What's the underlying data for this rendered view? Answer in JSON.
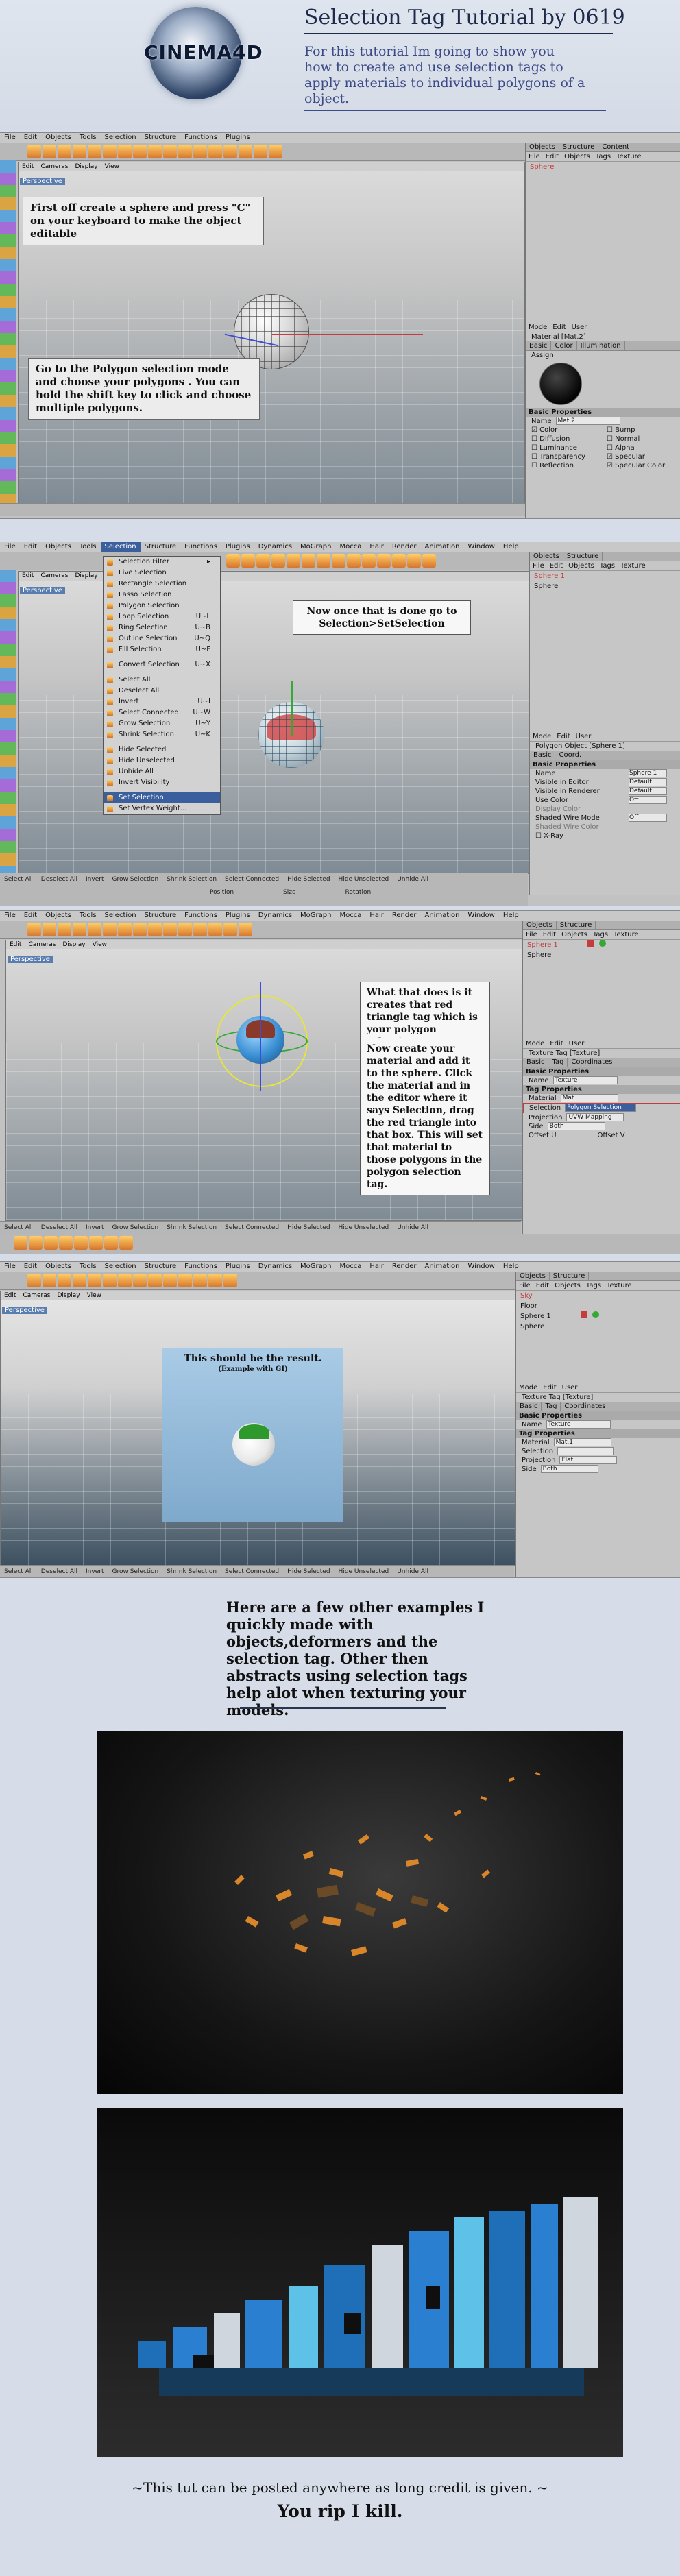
{
  "header": {
    "logo_text": "CINEMA4D",
    "title": "Selection Tag Tutorial by 0619",
    "intro": "For this tutorial Im going to show you how to create and use selection tags to apply materials to individual polygons of a object."
  },
  "app": {
    "menu": [
      "File",
      "Edit",
      "Objects",
      "Tools",
      "Selection",
      "Structure",
      "Functions",
      "Plugins",
      "Dynamics",
      "MoGraph",
      "Mocca",
      "Hair",
      "Render",
      "Animation",
      "Window",
      "Help"
    ],
    "viewport_menu": [
      "Edit",
      "Cameras",
      "Display",
      "View"
    ],
    "viewport_label": "Perspective",
    "panel_tabs": [
      "Objects",
      "Structure",
      "Content"
    ],
    "panel_menu": [
      "File",
      "Edit",
      "Objects",
      "Tags",
      "Texture"
    ],
    "attr_menu": [
      "Mode",
      "Edit",
      "User"
    ],
    "bottom_items": [
      "Select All",
      "Deselect All",
      "Invert",
      "Grow Selection",
      "Shrink Selection",
      "Select Connected",
      "Hide Selected",
      "Hide Unselected",
      "Unhide All"
    ]
  },
  "steps": [
    {
      "callouts": [
        "First off create a sphere and press \"C\" on your keyboard to make the object editable",
        "Go to the Polygon selection mode and choose your polygons . You can hold the shift key to click and choose multiple polygons."
      ],
      "objects": [
        "Sphere"
      ],
      "attr_title": "Material [Mat.2]",
      "attr_tabs": [
        "Basic",
        "Color",
        "Illumination"
      ],
      "section": "Basic Properties",
      "name_label": "Name",
      "name_value": "Mat.2",
      "checks_left": [
        "Color",
        "Diffusion",
        "Luminance",
        "Transparency",
        "Reflection"
      ],
      "checks_right": [
        "Bump",
        "Normal",
        "Alpha",
        "Specular",
        "Specular Color"
      ],
      "assign_label": "Assign"
    },
    {
      "callout": "Now once that is done go to Selection>SetSelection",
      "objects": [
        "Sphere 1",
        "Sphere"
      ],
      "dropdown": [
        {
          "label": "Selection Filter",
          "sc": ""
        },
        {
          "label": "Live Selection",
          "sc": ""
        },
        {
          "label": "Rectangle Selection",
          "sc": ""
        },
        {
          "label": "Lasso Selection",
          "sc": ""
        },
        {
          "label": "Polygon Selection",
          "sc": ""
        },
        {
          "label": "Loop Selection",
          "sc": "U~L"
        },
        {
          "label": "Ring Selection",
          "sc": "U~B"
        },
        {
          "label": "Outline Selection",
          "sc": "U~Q"
        },
        {
          "label": "Fill Selection",
          "sc": "U~F"
        },
        {
          "label": "Convert Selection",
          "sc": "U~X"
        },
        {
          "label": "Select All",
          "sc": ""
        },
        {
          "label": "Deselect All",
          "sc": ""
        },
        {
          "label": "Invert",
          "sc": "U~I"
        },
        {
          "label": "Select Connected",
          "sc": "U~W"
        },
        {
          "label": "Grow Selection",
          "sc": "U~Y"
        },
        {
          "label": "Shrink Selection",
          "sc": "U~K"
        },
        {
          "label": "Hide Selected",
          "sc": ""
        },
        {
          "label": "Hide Unselected",
          "sc": ""
        },
        {
          "label": "Unhide All",
          "sc": ""
        },
        {
          "label": "Invert Visibility",
          "sc": ""
        },
        {
          "label": "Set Selection",
          "sc": ""
        },
        {
          "label": "Set Vertex Weight...",
          "sc": ""
        }
      ],
      "attr_title": "Polygon Object [Sphere 1]",
      "attr_tabs": [
        "Basic",
        "Coord."
      ],
      "section": "Basic Properties",
      "props": [
        {
          "label": "Name",
          "value": "Sphere 1"
        },
        {
          "label": "Visible in Editor",
          "value": "Default"
        },
        {
          "label": "Visible in Renderer",
          "value": "Default"
        },
        {
          "label": "Use Color",
          "value": "Off"
        },
        {
          "label": "Display Color",
          "value": ""
        },
        {
          "label": "Shaded Wire Mode",
          "value": "Off"
        },
        {
          "label": "Shaded Wire Color",
          "value": ""
        }
      ],
      "xray_label": "X-Ray",
      "status_items": [
        "Position",
        "Size",
        "Rotation"
      ]
    },
    {
      "callouts": [
        "What that does is it creates that red triangle tag which is your polygon selection",
        "Now create your material and add it to the sphere. Click the material and in the editor where it says Selection, drag the red triangle into that box. This will set that material to those polygons in the polygon selection tag."
      ],
      "objects": [
        "Sphere 1",
        "Sphere"
      ],
      "attr_title": "Texture Tag [Texture]",
      "attr_tabs": [
        "Basic",
        "Tag",
        "Coordinates"
      ],
      "section": "Basic Properties",
      "name_label": "Name",
      "name_value": "Texture",
      "tag_section": "Tag Properties",
      "props": [
        {
          "label": "Material",
          "value": "Mat"
        },
        {
          "label": "Selection",
          "value": "Polygon Selection"
        },
        {
          "label": "Projection",
          "value": "UVW Mapping"
        },
        {
          "label": "Side",
          "value": "Both"
        }
      ],
      "offset_labels": [
        "Offset U",
        "Offset V"
      ]
    },
    {
      "callout_title": "This should be the result.",
      "callout_sub": "(Example with GI)",
      "objects": [
        "Sky",
        "Floor",
        "Sphere 1",
        "Sphere"
      ],
      "attr_title": "Texture Tag [Texture]",
      "attr_tabs": [
        "Basic",
        "Tag",
        "Coordinates"
      ],
      "section": "Basic Properties",
      "name_label": "Name",
      "name_value": "Texture",
      "tag_section": "Tag Properties",
      "props": [
        {
          "label": "Material",
          "value": "Mat.1"
        },
        {
          "label": "Selection",
          "value": ""
        },
        {
          "label": "Projection",
          "value": "Flat"
        },
        {
          "label": "Side",
          "value": "Both"
        }
      ]
    }
  ],
  "examples": {
    "text": "Here are a few other examples I quickly made with objects,deformers and the selection tag. Other then abstracts using selection tags help alot when texturing your models."
  },
  "footer": {
    "line1": "~This tut can be posted anywhere as long credit is given. ~",
    "line2": "You rip I kill."
  },
  "colors": {
    "background": "#d7dde8",
    "title": "#1d2a4a",
    "intro": "#3c4a86",
    "selection_red": "#c63b3b",
    "accent_orange": "#e08a2a",
    "render_blue": "#2a7fd0"
  }
}
